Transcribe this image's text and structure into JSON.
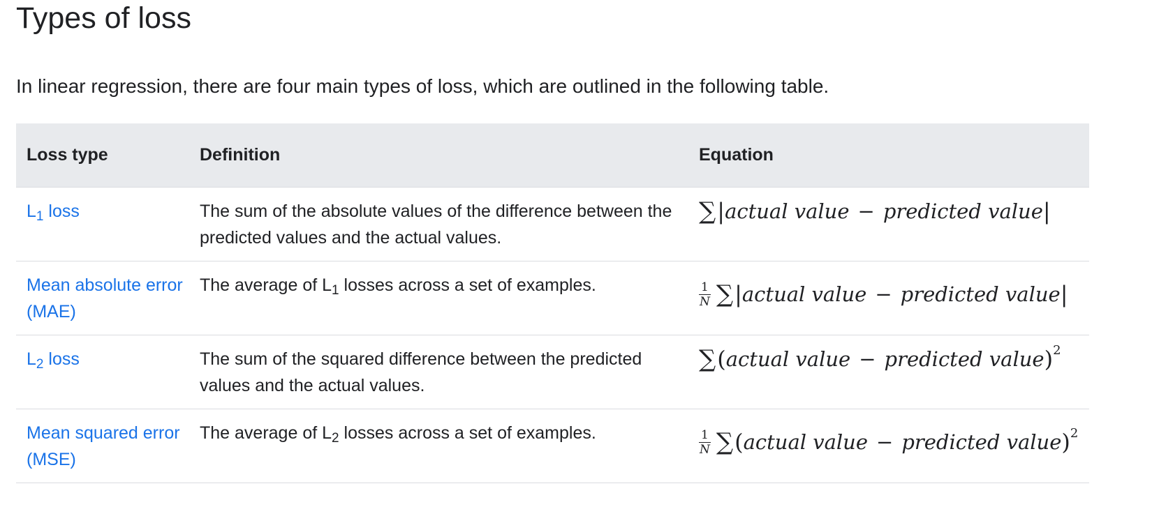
{
  "page": {
    "title": "Types of loss",
    "intro": "In linear regression, there are four main types of loss, which are outlined in the following table."
  },
  "table": {
    "headers": [
      "Loss type",
      "Definition",
      "Equation"
    ],
    "rows": [
      {
        "name_main": "L",
        "name_sub": "1",
        "name_rest": " loss",
        "def_pre": "The sum of the absolute values of the difference between the predicted values and the actual values.",
        "def_sub": "",
        "def_post": "",
        "eq_frac_num": "",
        "eq_frac_den": "",
        "eq_sigma": "∑",
        "eq_open": "|",
        "eq_left": "actual value",
        "eq_minus": "−",
        "eq_right": "predicted value",
        "eq_close": "|",
        "eq_exp": ""
      },
      {
        "name_main": "Mean absolute error (MAE)",
        "name_sub": "",
        "name_rest": "",
        "def_pre": "The average of L",
        "def_sub": "1",
        "def_post": " losses across a set of examples.",
        "eq_frac_num": "1",
        "eq_frac_den": "N",
        "eq_sigma": "∑",
        "eq_open": "|",
        "eq_left": "actual value",
        "eq_minus": "−",
        "eq_right": "predicted value",
        "eq_close": "|",
        "eq_exp": ""
      },
      {
        "name_main": "L",
        "name_sub": "2",
        "name_rest": " loss",
        "def_pre": "The sum of the squared difference between the predicted values and the actual values.",
        "def_sub": "",
        "def_post": "",
        "eq_frac_num": "",
        "eq_frac_den": "",
        "eq_sigma": "∑",
        "eq_open": "(",
        "eq_left": "actual value",
        "eq_minus": "−",
        "eq_right": "predicted value",
        "eq_close": ")",
        "eq_exp": "2"
      },
      {
        "name_main": "Mean squared error (MSE)",
        "name_sub": "",
        "name_rest": "",
        "def_pre": "The average of L",
        "def_sub": "2",
        "def_post": " losses across a set of examples.",
        "eq_frac_num": "1",
        "eq_frac_den": "N",
        "eq_sigma": "∑",
        "eq_open": "(",
        "eq_left": "actual value",
        "eq_minus": "−",
        "eq_right": "predicted value",
        "eq_close": ")",
        "eq_exp": "2"
      }
    ]
  },
  "colors": {
    "link": "#1a73e8",
    "header_bg": "#e8eaed",
    "text": "#202124",
    "border": "#dadce0"
  }
}
